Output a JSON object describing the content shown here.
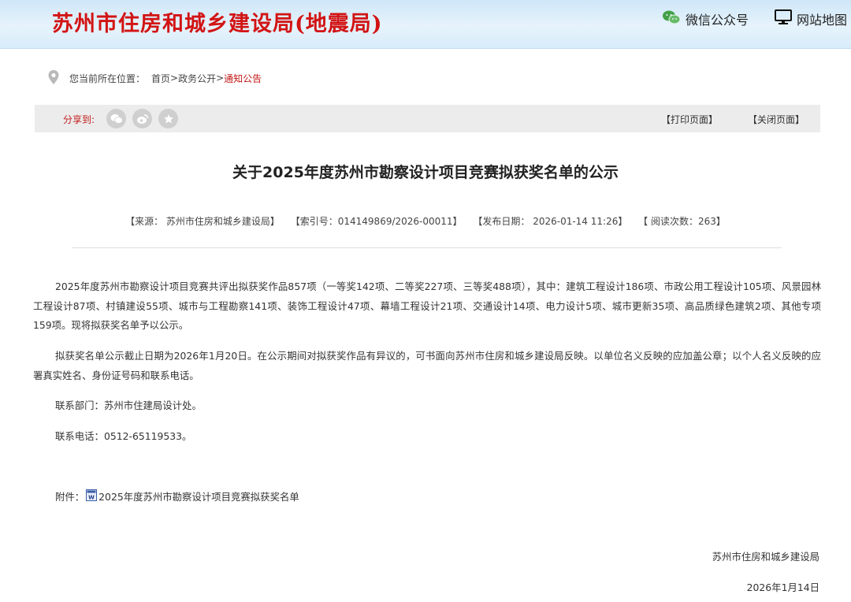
{
  "header": {
    "site_title": "苏州市住房和城乡建设局(地震局)",
    "wechat_label": "微信公众号",
    "sitemap_label": "网站地图"
  },
  "breadcrumb": {
    "prefix": "您当前所在位置：",
    "items": [
      "首页",
      "政务公开",
      "通知公告"
    ],
    "separator": ">"
  },
  "share_bar": {
    "label": "分享到:",
    "buttons": [
      "wechat-share",
      "weibo-share",
      "favorite-share"
    ],
    "print_label": "【打印页面】",
    "close_label": "【关闭页面】"
  },
  "article": {
    "title": "关于2025年度苏州市勘察设计项目竞赛拟获奖名单的公示",
    "meta": {
      "source": "【来源： 苏州市住房和城乡建设局】",
      "index": "【索引号：014149869/2026-00011】",
      "date": "【发布日期： 2026-01-14 11:26】",
      "views": "【 阅读次数：263】"
    },
    "paragraphs": [
      "2025年度苏州市勘察设计项目竞赛共评出拟获奖作品857项（一等奖142项、二等奖227项、三等奖488项），其中：建筑工程设计186项、市政公用工程设计105项、风景园林工程设计87项、村镇建设55项、城市与工程勘察141项、装饰工程设计47项、幕墙工程设计21项、交通设计14项、电力设计5项、城市更新35项、高品质绿色建筑2项、其他专项159项。现将拟获奖名单予以公示。",
      "拟获奖名单公示截止日期为2026年1月20日。在公示期间对拟获奖作品有异议的，可书面向苏州市住房和城乡建设局反映。以单位名义反映的应加盖公章；以个人名义反映的应署真实姓名、身份证号码和联系电话。",
      "联系部门：苏州市住建局设计处。",
      "联系电话：0512-65119533。"
    ],
    "attachment_prefix": "附件：",
    "attachment_name": "2025年度苏州市勘察设计项目竞赛拟获奖名单",
    "signature_org": "苏州市住房和城乡建设局",
    "signature_date": "2026年1月14日"
  },
  "colors": {
    "title_red": "#d21414",
    "link_red": "#c41a1a",
    "header_blue": "#cfe7f8",
    "bar_gray": "#ececec"
  }
}
